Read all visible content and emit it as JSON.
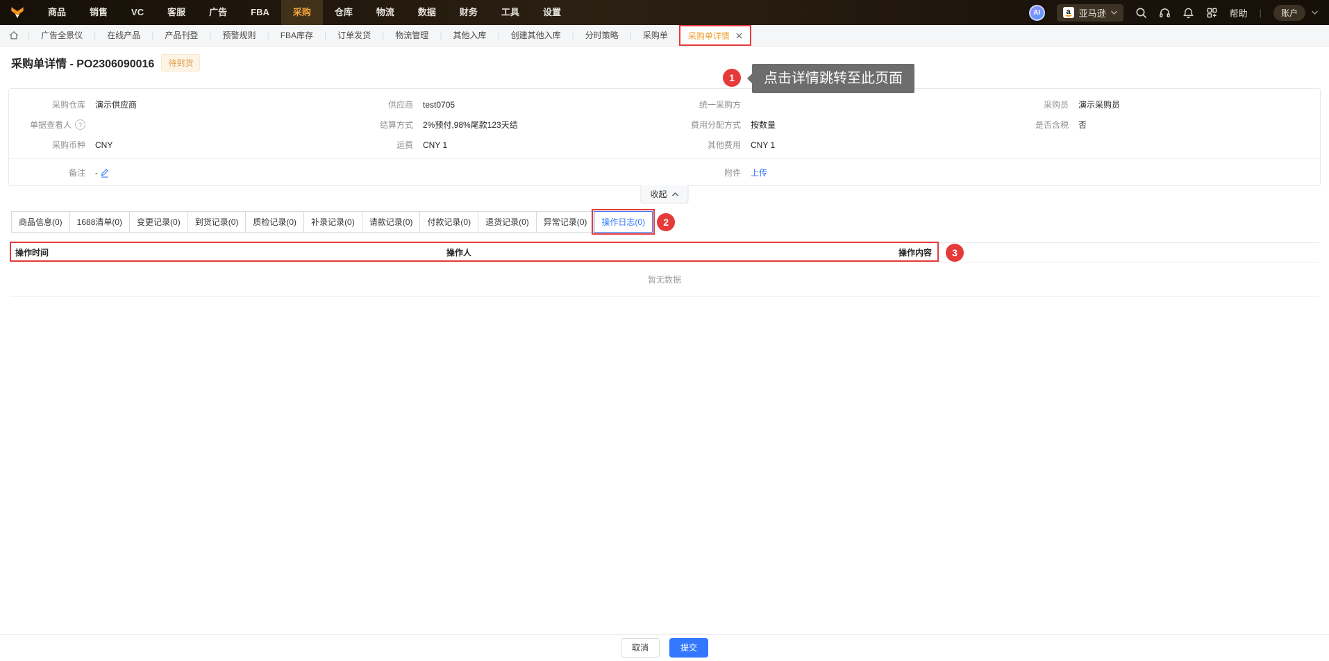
{
  "colors": {
    "accent_orange": "#f2a33c",
    "accent_blue": "#3377fe",
    "annotation_red": "#e63a3a",
    "status_badge_bg": "#fdf4e6"
  },
  "top_nav": {
    "items": [
      "商品",
      "销售",
      "VC",
      "客服",
      "广告",
      "FBA",
      "采购",
      "仓库",
      "物流",
      "数据",
      "财务",
      "工具",
      "设置"
    ],
    "active_item": "采购",
    "ai_badge": "AI",
    "marketplace": "亚马逊",
    "help": "帮助",
    "account": "账户"
  },
  "tab_bar": {
    "tabs": [
      "广告全景仪",
      "在线产品",
      "产品刊登",
      "预警规则",
      "FBA库存",
      "订单发货",
      "物流管理",
      "其他入库",
      "创建其他入库",
      "分时策略",
      "采购单"
    ],
    "active_tab": "采购单详情"
  },
  "page": {
    "title": "采购单详情 - PO2306090016",
    "status_badge": "待到货"
  },
  "annotations": {
    "step1": "1",
    "step1_tooltip": "点击详情跳转至此页面",
    "step2": "2",
    "step3": "3"
  },
  "form": {
    "row1": [
      {
        "label": "采购仓库",
        "value": "演示供应商"
      },
      {
        "label": "供应商",
        "value": "test0705"
      },
      {
        "label": "统一采购方",
        "value": ""
      },
      {
        "label": "采购员",
        "value": "演示采购员"
      }
    ],
    "row2": [
      {
        "label": "单据查看人",
        "value": ""
      },
      {
        "label": "结算方式",
        "value": "2%预付,98%尾款123天结"
      },
      {
        "label": "费用分配方式",
        "value": "按数量"
      },
      {
        "label": "是否含税",
        "value": "否"
      }
    ],
    "row3": [
      {
        "label": "采购币种",
        "value": "CNY"
      },
      {
        "label": "运费",
        "value": "CNY 1"
      },
      {
        "label": "其他费用",
        "value": "CNY 1"
      }
    ],
    "row4": [
      {
        "label": "备注",
        "value": "-"
      },
      {
        "label": "附件",
        "value": "上传"
      }
    ],
    "collapse_label": "收起"
  },
  "record_tabs": [
    "商品信息(0)",
    "1688清单(0)",
    "变更记录(0)",
    "到货记录(0)",
    "质检记录(0)",
    "补录记录(0)",
    "请款记录(0)",
    "付款记录(0)",
    "退货记录(0)",
    "异常记录(0)"
  ],
  "record_tabs_active": "操作日志(0)",
  "log_table": {
    "headers": [
      "操作时间",
      "操作人",
      "操作内容"
    ],
    "empty_text": "暂无数据",
    "rows": []
  },
  "footer": {
    "cancel": "取消",
    "submit": "提交"
  }
}
